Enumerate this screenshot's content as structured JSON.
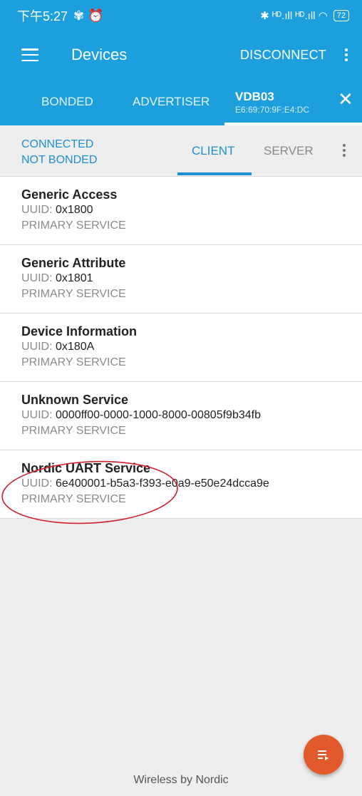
{
  "status_bar": {
    "time": "下午5:27",
    "glyphs": "✾ ⏰",
    "signal": "✱ ᴴᴰ.ıll ᴴᴰ.ıll ◠",
    "battery": "72"
  },
  "app_bar": {
    "title": "Devices",
    "disconnect_label": "DISCONNECT"
  },
  "device_tabs": [
    {
      "label": "BONDED"
    },
    {
      "label": "ADVERTISER"
    },
    {
      "label": "VDB03",
      "sub": "E6:69:70:9F:E4:DC"
    }
  ],
  "connection": {
    "state": "CONNECTED",
    "bond": "NOT BONDED"
  },
  "sub_tabs": {
    "client": "CLIENT",
    "server": "SERVER"
  },
  "uuid_label": "UUID:",
  "services": [
    {
      "name": "Generic Access",
      "uuid": "0x1800",
      "type": "PRIMARY SERVICE"
    },
    {
      "name": "Generic Attribute",
      "uuid": "0x1801",
      "type": "PRIMARY SERVICE"
    },
    {
      "name": "Device Information",
      "uuid": "0x180A",
      "type": "PRIMARY SERVICE"
    },
    {
      "name": "Unknown Service",
      "uuid": "0000ff00-0000-1000-8000-00805f9b34fb",
      "type": "PRIMARY SERVICE"
    },
    {
      "name": "Nordic UART Service",
      "uuid": "6e400001-b5a3-f393-e0a9-e50e24dcca9e",
      "type": "PRIMARY SERVICE"
    }
  ],
  "footer": "Wireless by Nordic",
  "colors": {
    "primary": "#1c9fdc",
    "accent": "#1c90d0",
    "fab": "#e25a2b",
    "annotation": "#d0202a"
  }
}
